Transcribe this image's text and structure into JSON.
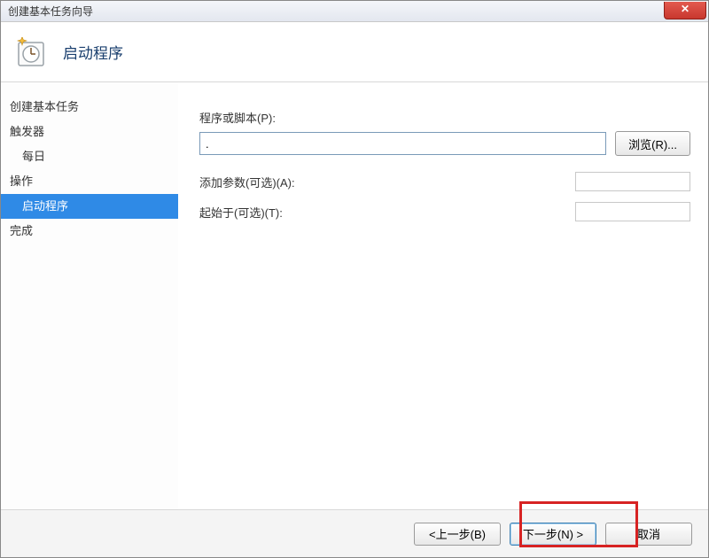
{
  "window": {
    "title": "创建基本任务向导",
    "close_glyph": "✕"
  },
  "header": {
    "title": "启动程序"
  },
  "sidebar": {
    "create_task": "创建基本任务",
    "trigger": "触发器",
    "trigger_sub": "每日",
    "action": "操作",
    "action_sub": "启动程序",
    "finish": "完成"
  },
  "form": {
    "script_label": "程序或脚本(P):",
    "script_value": ".",
    "browse_label": "浏览(R)...",
    "args_label": "添加参数(可选)(A):",
    "args_value": "",
    "startin_label": "起始于(可选)(T):",
    "startin_value": ""
  },
  "footer": {
    "back": "<上一步(B)",
    "next": "下一步(N) >",
    "cancel": "取消"
  }
}
